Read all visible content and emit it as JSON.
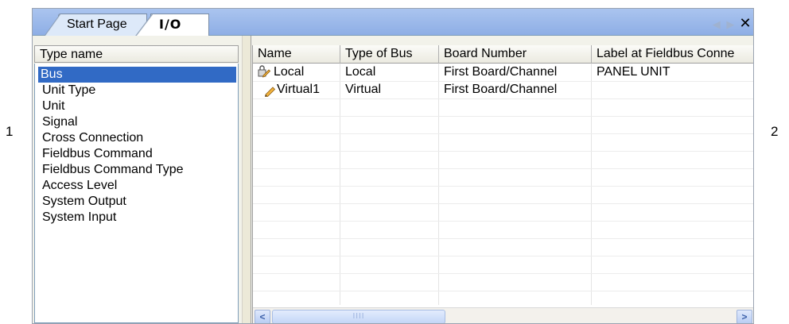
{
  "callouts": {
    "left": "1",
    "right": "2"
  },
  "tabs": [
    {
      "label": "Start Page",
      "active": false
    },
    {
      "label": "I/O",
      "active": true
    }
  ],
  "tab_controls": {
    "prev": "◀",
    "next": "▶",
    "close": "✕"
  },
  "left_pane": {
    "header": "Type name",
    "items": [
      {
        "label": "Bus",
        "selected": true
      },
      {
        "label": "Unit Type"
      },
      {
        "label": "Unit"
      },
      {
        "label": "Signal"
      },
      {
        "label": "Cross Connection"
      },
      {
        "label": "Fieldbus Command"
      },
      {
        "label": "Fieldbus Command Type"
      },
      {
        "label": "Access Level"
      },
      {
        "label": "System Output"
      },
      {
        "label": "System Input"
      }
    ]
  },
  "grid": {
    "columns": [
      "Name",
      "Type of Bus",
      "Board Number",
      "Label at Fieldbus Conne"
    ],
    "rows": [
      {
        "icon": "lock-icon",
        "name": "Local",
        "type": "Local",
        "board": "First Board/Channel",
        "label": "PANEL UNIT"
      },
      {
        "icon": "pencil-icon",
        "name": "Virtual1",
        "type": "Virtual",
        "board": "First Board/Channel",
        "label": ""
      }
    ]
  },
  "scrollbar": {
    "left": "<",
    "right": ">",
    "thumb": "IIII"
  }
}
